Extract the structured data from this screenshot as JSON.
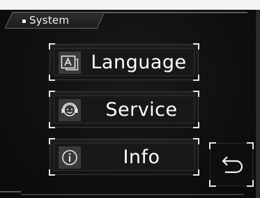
{
  "header": {
    "title": "System",
    "title_dot_icon": "square-bullet-icon"
  },
  "menu": {
    "items": [
      {
        "label": "Language",
        "icon": "language-icon"
      },
      {
        "label": "Service",
        "icon": "service-face-icon"
      },
      {
        "label": "Info",
        "icon": "info-icon"
      }
    ]
  },
  "back_button": {
    "icon": "back-arrow-icon"
  },
  "colors": {
    "background": "#0f0f0f",
    "text": "#ffffff",
    "accent_corner": "#e8e8e8",
    "icon_bg": "#3a3a3a"
  }
}
